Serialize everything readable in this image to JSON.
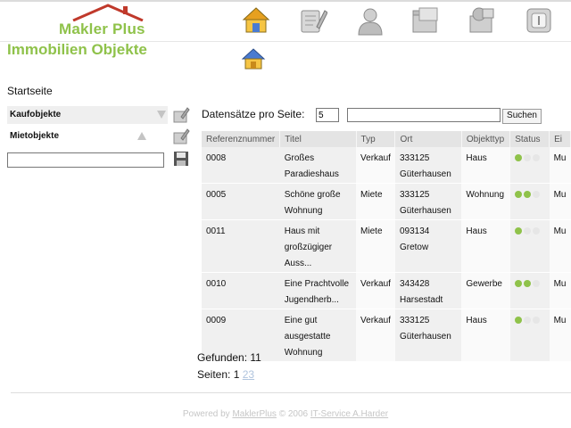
{
  "header": {
    "logo_text": "Makler Plus",
    "nav": [
      "house-icon",
      "notepad-icon",
      "user-icon",
      "folder-icon",
      "tools-icon",
      "power-icon"
    ]
  },
  "page": {
    "title": "Immobilien Objekte",
    "breadcrumb": "Startseite"
  },
  "sidebar": {
    "items": [
      {
        "label": "Kaufobjekte",
        "arrow": "down"
      },
      {
        "label": "Mietobjekte",
        "arrow": "up"
      }
    ],
    "input_value": ""
  },
  "controls": {
    "per_page_label": "Datensätze pro Seite:",
    "per_page_value": "5",
    "search_value": "",
    "search_button": "Suchen"
  },
  "table": {
    "headers": [
      "Referenznummer",
      "Titel",
      "Typ",
      "Ort",
      "Objekttyp",
      "Status",
      "Ei"
    ],
    "rows": [
      {
        "ref": "0008",
        "titel": "Großes Paradieshaus",
        "typ": "Verkauf",
        "ort": "333125 Güterhausen",
        "objekttyp": "Haus",
        "status": [
          1,
          0,
          0
        ],
        "extra": "Mu"
      },
      {
        "ref": "0005",
        "titel": "Schöne große Wohnung",
        "typ": "Miete",
        "ort": "333125 Güterhausen",
        "objekttyp": "Wohnung",
        "status": [
          1,
          1,
          0
        ],
        "extra": "Mu"
      },
      {
        "ref": "0011",
        "titel": "Haus mit großzügiger Auss...",
        "typ": "Miete",
        "ort": "093134 Gretow",
        "objekttyp": "Haus",
        "status": [
          1,
          0,
          0
        ],
        "extra": "Mu"
      },
      {
        "ref": "0010",
        "titel": "Eine Prachtvolle Jugendherb...",
        "typ": "Verkauf",
        "ort": "343428 Harsestadt",
        "objekttyp": "Gewerbe",
        "status": [
          1,
          1,
          0
        ],
        "extra": "Mu"
      },
      {
        "ref": "0009",
        "titel": "Eine gut ausgestatte Wohnung",
        "typ": "Verkauf",
        "ort": "333125 Güterhausen",
        "objekttyp": "Haus",
        "status": [
          1,
          0,
          0
        ],
        "extra": "Mu"
      }
    ]
  },
  "results": {
    "found": "Gefunden: 11",
    "pages_label": "Seiten:",
    "pages": [
      "1",
      "2",
      "3"
    ]
  },
  "footer": {
    "prefix": "Powered by",
    "product": "MaklerPlus",
    "middle": "© 2006",
    "company": "IT-Service A.Harder"
  },
  "colors": {
    "brand_green": "#8fc24a",
    "logo_roof": "#c0392b"
  }
}
